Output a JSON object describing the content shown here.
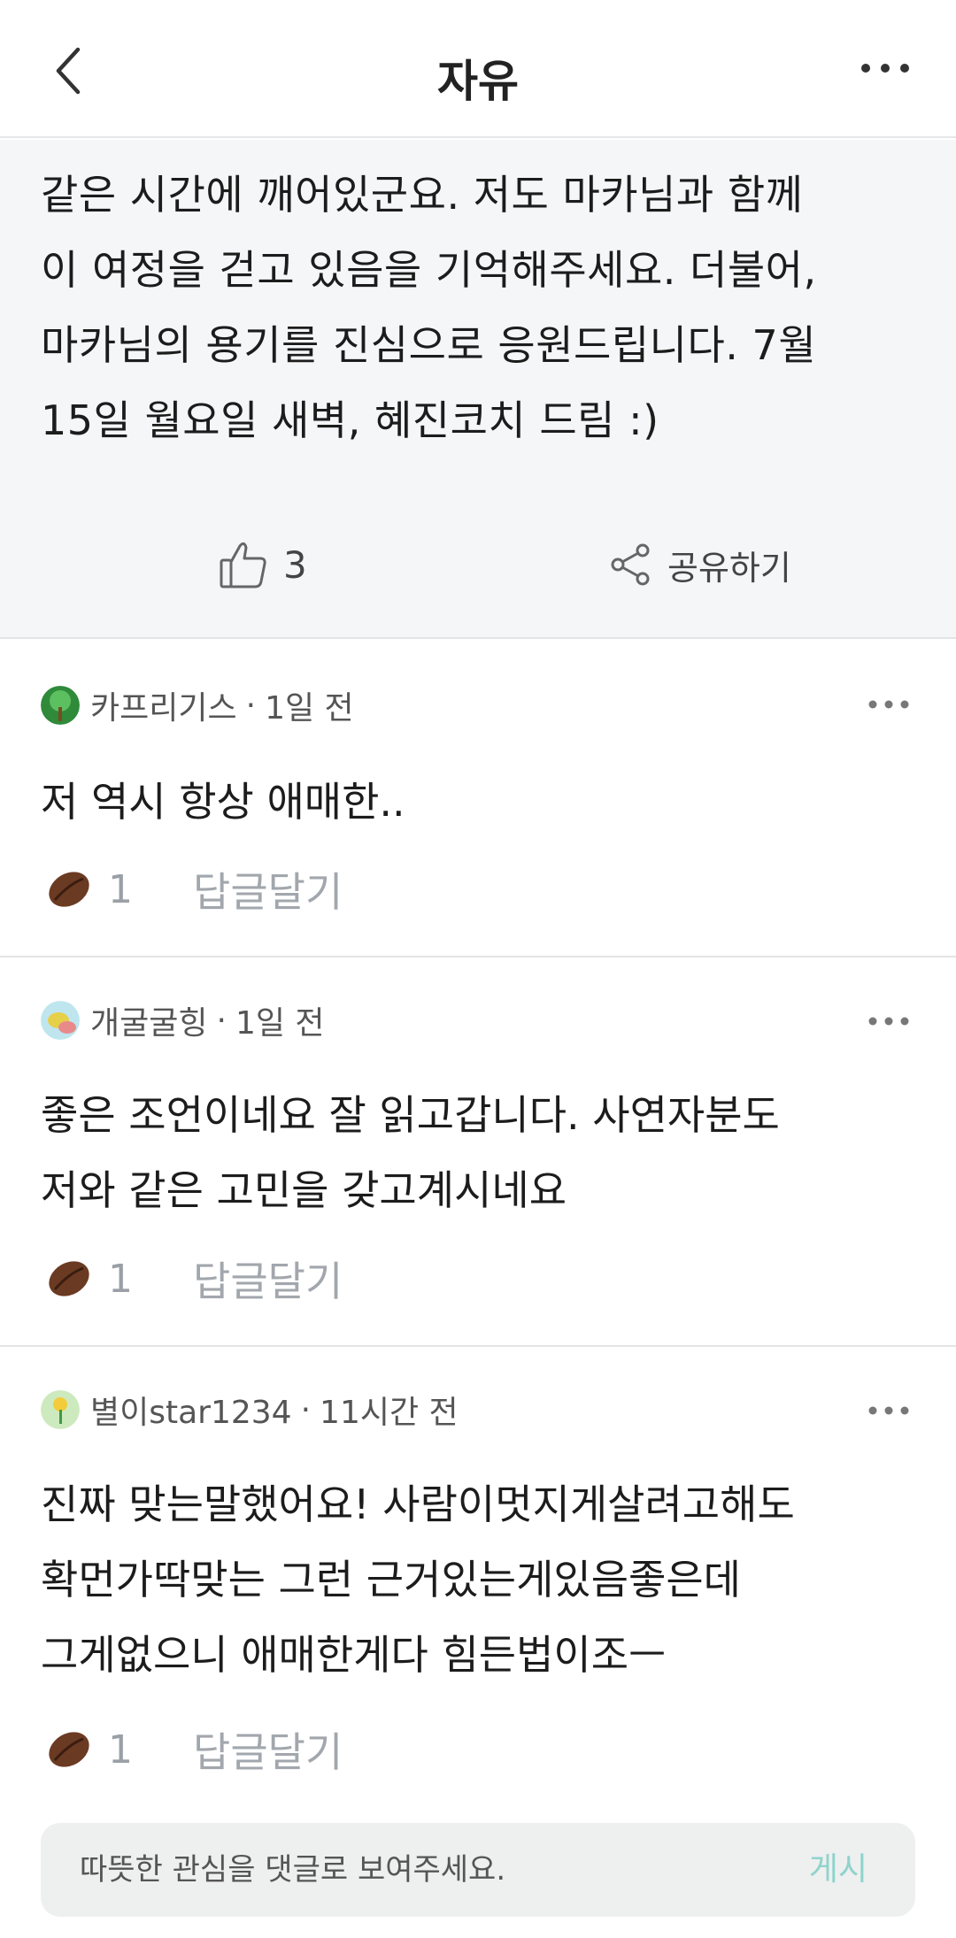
{
  "header": {
    "title": "자유"
  },
  "post": {
    "lines": [
      "같은 시간에 깨어있군요. 저도 마카님과 함께",
      "이 여정을 걷고 있음을 기억해주세요. 더불어,",
      "마카님의 용기를 진심으로 응원드립니다. 7월",
      "15일 월요일 새벽, 혜진코치 드림 :)"
    ],
    "like_count": "3",
    "share_label": "공유하기"
  },
  "comments": [
    {
      "author": "카프리기스",
      "separator": "·",
      "time": "1일 전",
      "lines": [
        "저 역시 항상 애매한.."
      ],
      "bean_count": "1",
      "reply_label": "답글달기"
    },
    {
      "author": "개굴굴힝",
      "separator": "·",
      "time": "1일 전",
      "lines": [
        "좋은 조언이네요 잘 읽고갑니다. 사연자분도",
        "저와 같은 고민을 갖고계시네요"
      ],
      "bean_count": "1",
      "reply_label": "답글달기"
    },
    {
      "author": "별이star1234",
      "separator": "·",
      "time": "11시간 전",
      "lines": [
        "진짜 맞는말했어요! 사람이멋지게살려고해도",
        "확먼가딱맞는 그런 근거있는게있음좋은데",
        "그게없으니 애매한게다 힘든법이조ㅡ"
      ],
      "bean_count": "1",
      "reply_label": "답글달기"
    }
  ],
  "input": {
    "placeholder": "따뜻한 관심을 댓글로 보여주세요.",
    "post_label": "게시"
  },
  "colors": {
    "accent": "#8fd3cc",
    "muted": "#a2a7ad",
    "bg": "#f5f6f7"
  }
}
